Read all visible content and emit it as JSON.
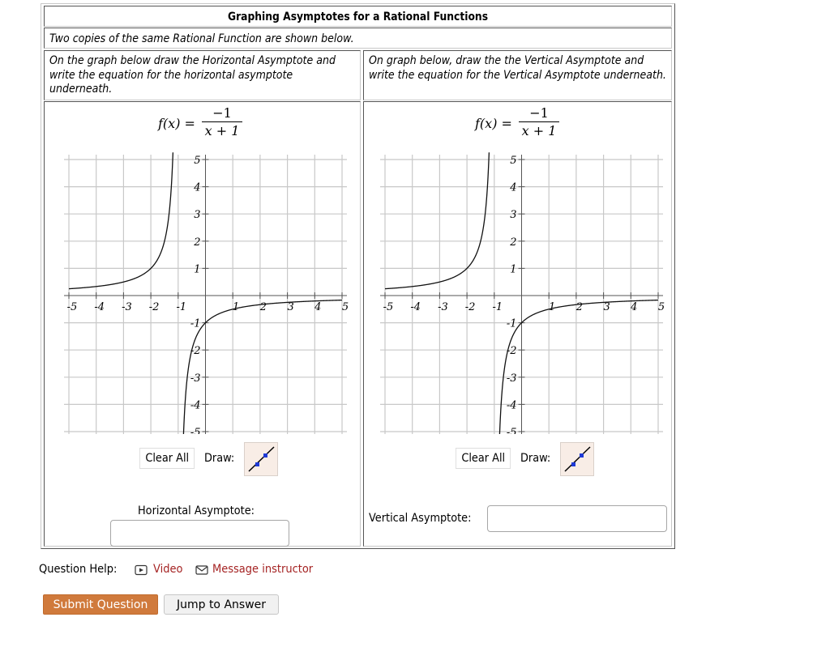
{
  "question": {
    "title": "Graphing Asymptotes for a Rational Functions",
    "intro": "Two copies of the same Rational Function are shown below.",
    "left": {
      "instruction": "On the graph below draw the Horizontal Asymptote and write the equation for the horizontal asymptote underneath.",
      "answer_label": "Horizontal Asymptote:",
      "answer_value": "",
      "clear_label": "Clear All",
      "draw_label": "Draw:",
      "draw_tool_icon": "line-segment-icon"
    },
    "right": {
      "instruction": "On graph below, draw the the Vertical Asymptote and write the equation for the Vertical Asymptote underneath.",
      "answer_label": "Vertical Asymptote:",
      "answer_value": "",
      "clear_label": "Clear All",
      "draw_label": "Draw:",
      "draw_tool_icon": "line-segment-icon"
    },
    "function": {
      "lhs": "f(x) =",
      "numerator": "−1",
      "denominator": "x + 1"
    }
  },
  "chart_data": {
    "type": "line",
    "title": "f(x) = -1/(x+1)",
    "xlabel": "",
    "ylabel": "",
    "xlim": [
      -5,
      5
    ],
    "ylim": [
      -5,
      5
    ],
    "grid": true,
    "x_ticks": [
      "-5",
      "-4",
      "-3",
      "-2",
      "-1",
      "1",
      "2",
      "3",
      "4",
      "5"
    ],
    "y_ticks": [
      "5",
      "4",
      "3",
      "2",
      "1",
      "-1",
      "-2",
      "-3",
      "-4",
      "-5"
    ],
    "series": [
      {
        "name": "f(x) = -1/(x+1)",
        "expression": "-1/(x+1)",
        "vertical_asymptote": -1,
        "horizontal_asymptote": 0,
        "sample_points": [
          [
            -5,
            0.25
          ],
          [
            -4,
            0.333
          ],
          [
            -3,
            0.5
          ],
          [
            -2,
            1
          ],
          [
            -1.5,
            2
          ],
          [
            -1.2,
            5
          ],
          [
            -0.8,
            -5
          ],
          [
            -0.5,
            -2
          ],
          [
            0,
            -1
          ],
          [
            1,
            -0.5
          ],
          [
            2,
            -0.333
          ],
          [
            3,
            -0.25
          ],
          [
            4,
            -0.2
          ],
          [
            5,
            -0.167
          ]
        ]
      }
    ]
  },
  "help": {
    "label": "Question Help:",
    "video_label": "Video",
    "video_icon": "video-play-icon",
    "message_label": "Message instructor",
    "message_icon": "envelope-icon"
  },
  "actions": {
    "submit_label": "Submit Question",
    "jump_label": "Jump to Answer"
  },
  "colors": {
    "link": "#a52424",
    "submit_bg": "#d07a3c",
    "draw_tool_bg": "#f8ede6",
    "draw_point": "#1f3bd6"
  }
}
